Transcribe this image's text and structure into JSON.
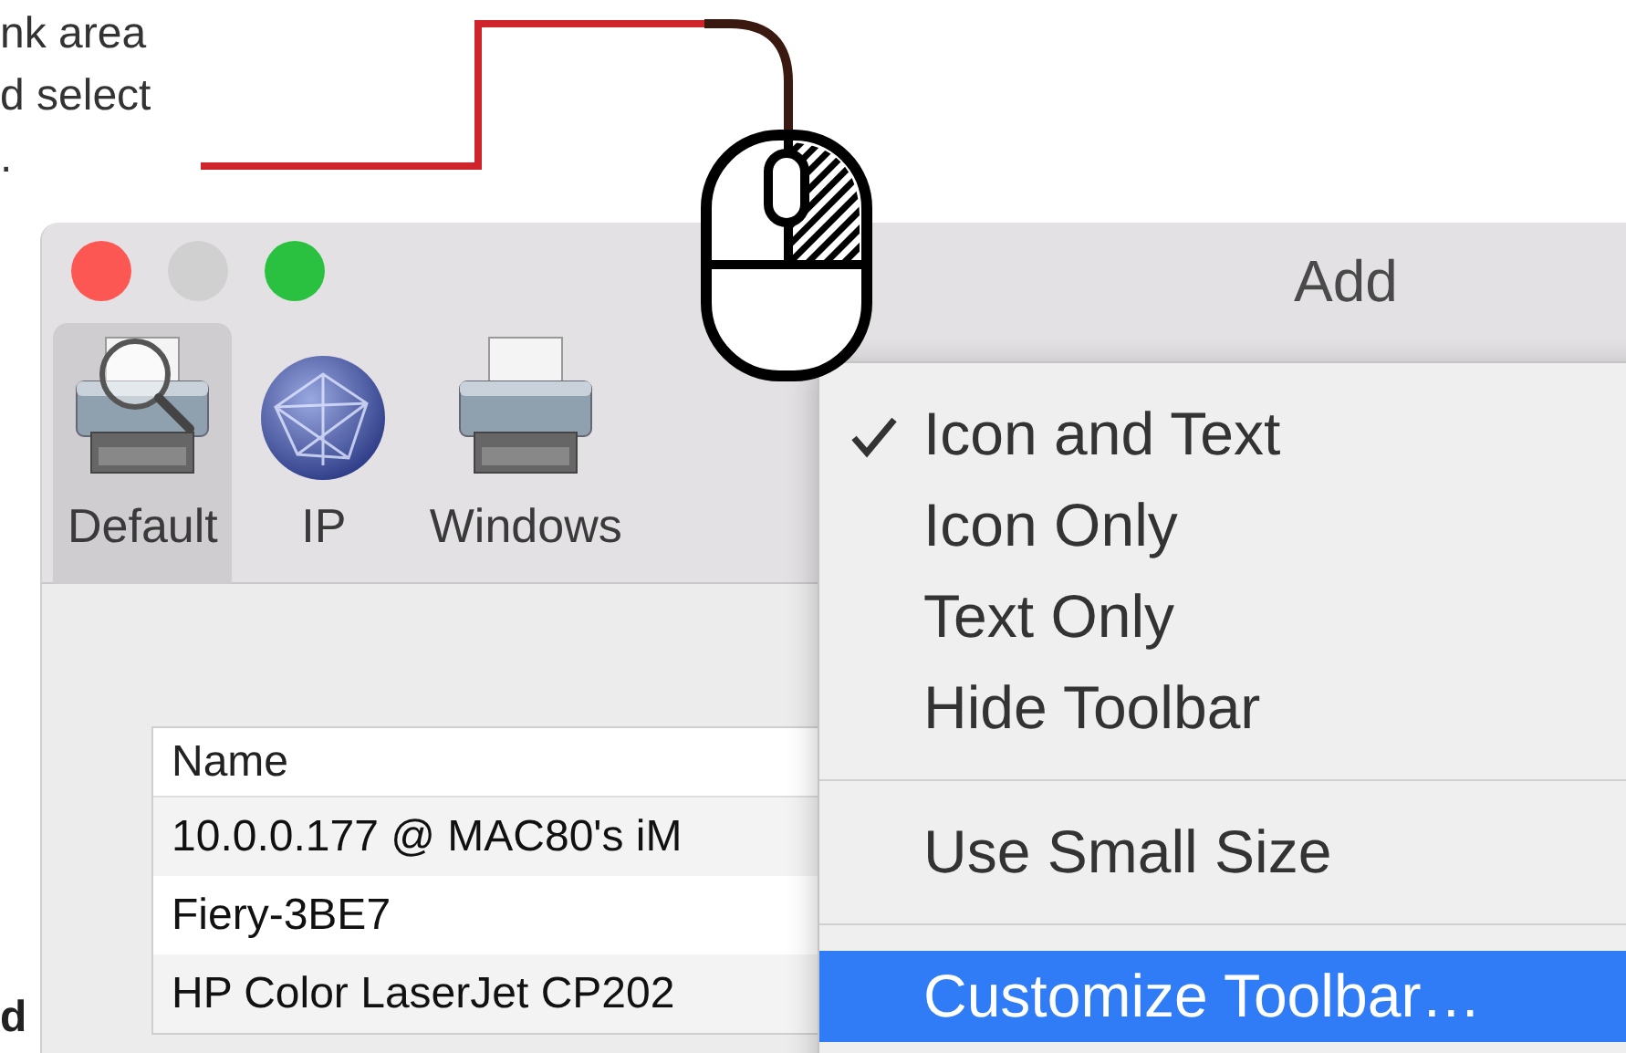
{
  "annotation": {
    "lines": [
      "nk area",
      "d select",
      "."
    ],
    "bottom_text": "d"
  },
  "window": {
    "title": "Add",
    "toolbar": [
      {
        "label": "Default",
        "selected": true,
        "kind": "search-printer"
      },
      {
        "label": "IP",
        "selected": false,
        "kind": "globe"
      },
      {
        "label": "Windows",
        "selected": false,
        "kind": "printer"
      }
    ]
  },
  "table": {
    "columns": [
      "Name"
    ],
    "rows": [
      "10.0.0.177 @ MAC80's iM",
      "Fiery-3BE7",
      "HP Color LaserJet CP202"
    ]
  },
  "context_menu": {
    "items": [
      {
        "kind": "item",
        "label": "Icon and Text",
        "checked": true,
        "selected": false
      },
      {
        "kind": "item",
        "label": "Icon Only",
        "checked": false,
        "selected": false
      },
      {
        "kind": "item",
        "label": "Text Only",
        "checked": false,
        "selected": false
      },
      {
        "kind": "item",
        "label": "Hide Toolbar",
        "checked": false,
        "selected": false
      },
      {
        "kind": "separator"
      },
      {
        "kind": "item",
        "label": "Use Small Size",
        "checked": false,
        "selected": false
      },
      {
        "kind": "separator"
      },
      {
        "kind": "item",
        "label": "Customize Toolbar…",
        "checked": false,
        "selected": true
      }
    ]
  }
}
